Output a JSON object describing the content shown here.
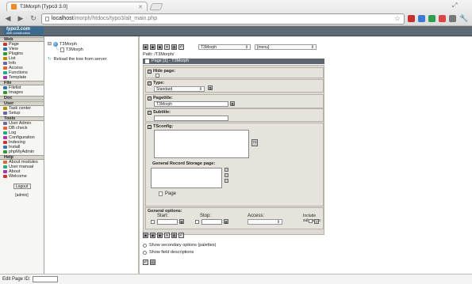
{
  "browser": {
    "tab_title": "T3Morph [Typo3 3.0]",
    "url_host": "localhost",
    "url_path": "/morph/htdocs/typo3/alt_main.php"
  },
  "header": {
    "logo_text": "typo3.com",
    "logo_sub": "web construction"
  },
  "modmenu": {
    "groups": [
      {
        "title": "Web",
        "items": [
          "Page",
          "View",
          "Plugins",
          "List",
          "Info",
          "Access",
          "Functions",
          "Template"
        ]
      },
      {
        "title": "File",
        "items": [
          "Filelist",
          "Images"
        ]
      },
      {
        "title": "Doc",
        "items": []
      },
      {
        "title": "User",
        "items": [
          "Task center",
          "Setup"
        ]
      },
      {
        "title": "Tools",
        "items": [
          "User Admin",
          "DB check",
          "Log",
          "Configuration",
          "Indexing",
          "Install",
          "phpMyAdmin"
        ]
      },
      {
        "title": "Help",
        "items": [
          "About modules",
          "User manual",
          "About",
          "Welcome"
        ]
      }
    ],
    "logout_label": "Logout",
    "user_label": "[admin]"
  },
  "tree": {
    "root": "T3Morph",
    "child": "T3Morph",
    "reload": "Reload the tree from server"
  },
  "content": {
    "select_page": "T3Morph",
    "select_menu": "[menu]",
    "path": "Path: /T3Morph/",
    "section_title": "Page [1] - T3Morph",
    "hide_page": "Hide page:",
    "type_label": "Type:",
    "type_value": "Standard",
    "pagetitle_label": "Pagetitle:",
    "pagetitle_value": "T3Morph",
    "subtitle_label": "Subtitle:",
    "tsconfig_label": "TSconfig:",
    "storage_label": "General Record Storage page:",
    "storage_page": "Page",
    "general_label": "General options:",
    "start_label": "Start:",
    "stop_label": "Stop:",
    "access_label": "Access:",
    "include_label": "Include subpages:",
    "opt_secondary": "Show secondary options (palettes)",
    "opt_descriptions": "Show field descriptions"
  },
  "status": {
    "edit_label": "Edit Page ID:"
  }
}
